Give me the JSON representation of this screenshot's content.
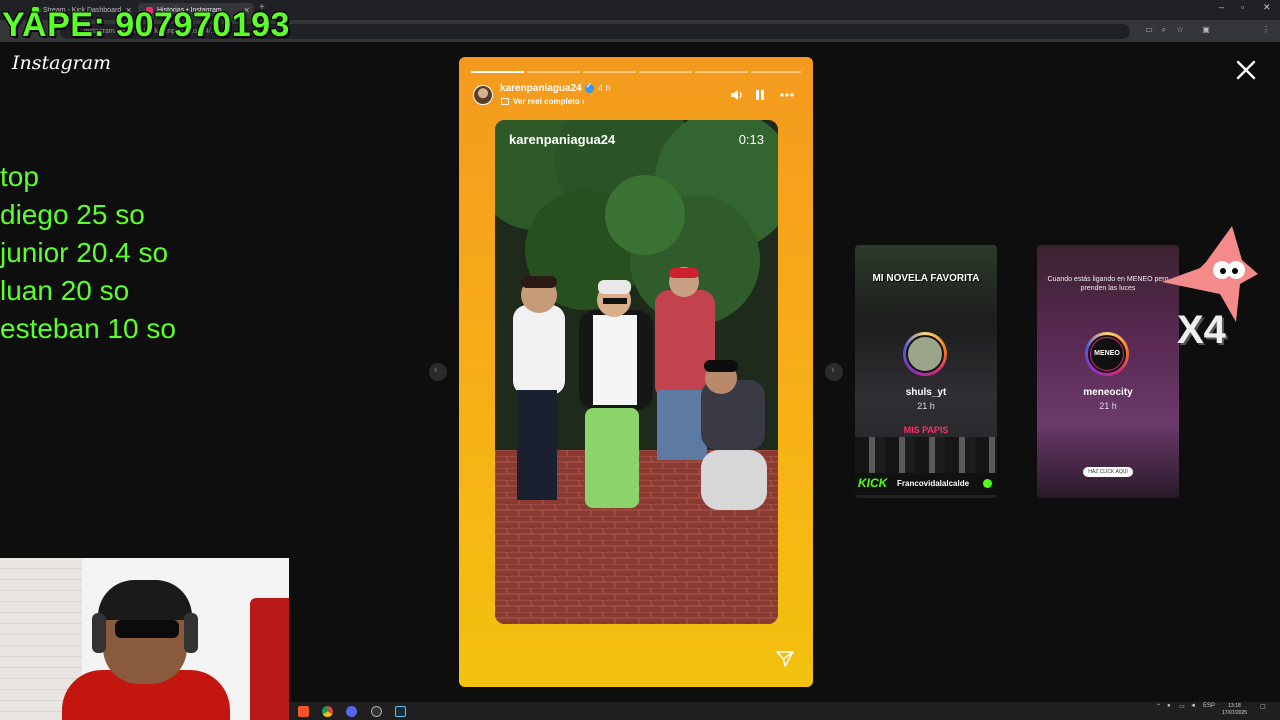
{
  "browser": {
    "tabs": [
      {
        "title": "Stream - Kick Dashboard",
        "favicon_color": "#53fc18"
      },
      {
        "title": "Historias • Instagram",
        "favicon_color": "#e1306c"
      }
    ],
    "url": "instagram.com/stories/karenpaniagua24/..."
  },
  "overlay": {
    "yape": "YAPE: 907970193",
    "list": [
      "top",
      "diego 25 so",
      "junior 20.4 so",
      "luan 20 so",
      "esteban 10 so"
    ],
    "color": "#5cff2a"
  },
  "instagram": {
    "logo": "Instagram"
  },
  "story": {
    "username": "karenpaniagua24",
    "time_ago": "4 h",
    "reel_link": "Ver reel completo",
    "video_username": "karenpaniagua24",
    "video_time": "0:13",
    "segments": 6,
    "segments_done": 1,
    "icons": [
      "volume-icon",
      "pause-icon",
      "more-icon",
      "send-icon",
      "close-icon"
    ]
  },
  "previews": [
    {
      "title": "MI NOVELA FAVORITA",
      "name": "shuls_yt",
      "time": "21 h",
      "caption": "MIS PAPIS",
      "kick_logo": "KICK",
      "kick_user": "Francovidalalcalde"
    },
    {
      "subtitle": "Cuando estás ligando en MENEO pero prenden las luces",
      "logo": "MENEO",
      "name": "meneocity",
      "time": "21 h",
      "cta": "HAZ CLICK AQUÍ",
      "sticker": "X4"
    }
  ],
  "taskbar": {
    "language": "ESP",
    "time": "13:18",
    "date": "17/07/2025"
  }
}
